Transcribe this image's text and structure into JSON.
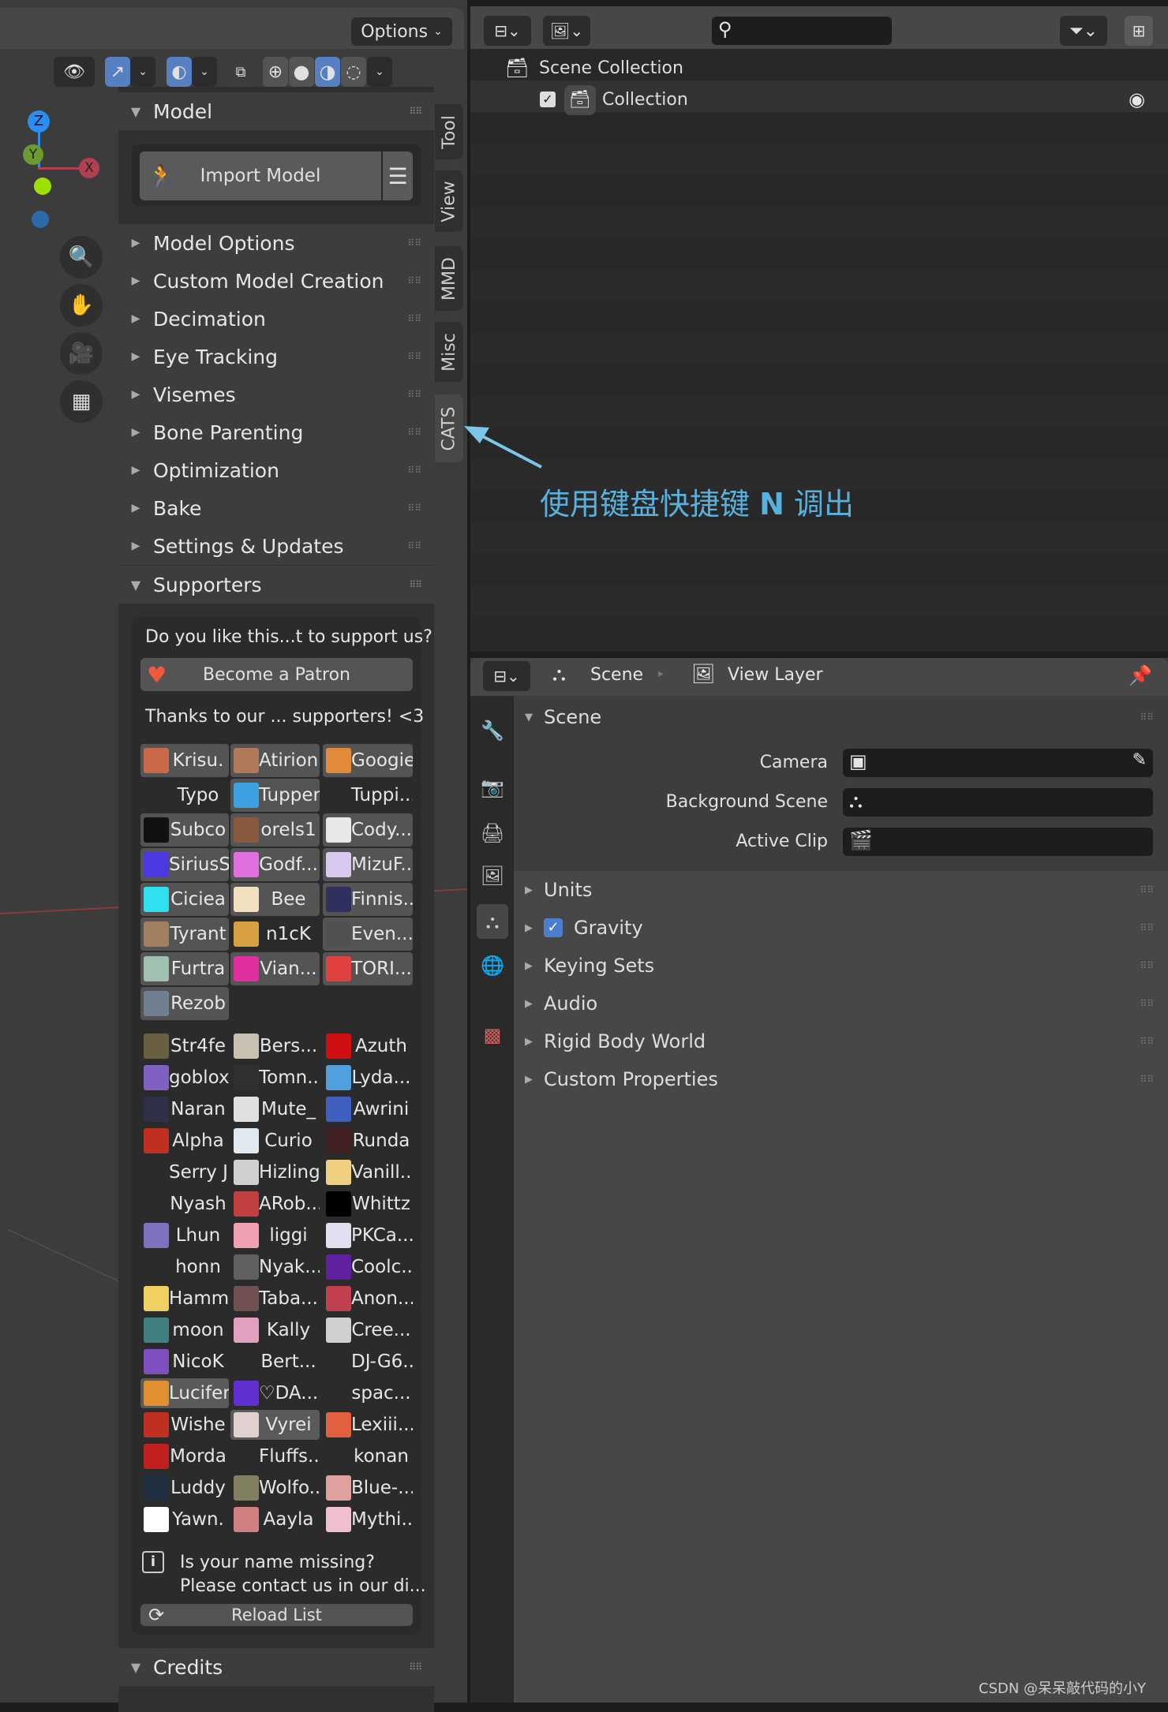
{
  "viewport": {
    "options_label": "Options",
    "gizmo": {
      "z": "Z",
      "y": "Y",
      "x": "X"
    },
    "tabs": [
      "Tool",
      "View",
      "MMD",
      "Misc",
      "CATS"
    ],
    "active_tab": "CATS"
  },
  "sidebar": {
    "model_header": "Model",
    "import_button": "Import Model",
    "items": [
      "Model Options",
      "Custom Model Creation",
      "Decimation",
      "Eye Tracking",
      "Visemes",
      "Bone Parenting",
      "Optimization",
      "Bake",
      "Settings & Updates"
    ],
    "supporters_header": "Supporters",
    "support_prompt": "Do you like this...t to support us?",
    "patron_button": "Become a Patron",
    "thanks": "Thanks to our ... supporters! <3",
    "tier1": [
      [
        "Krisu.",
        "#c86a4a",
        "box"
      ],
      [
        "Atirion",
        "#b07a5a",
        "box"
      ],
      [
        "Googie",
        "#e08a3a",
        "box"
      ],
      [
        "Typo",
        "",
        "dark"
      ],
      [
        "Tupper",
        "#3aa0e0",
        "box"
      ],
      [
        "Tuppi...",
        "",
        "dark"
      ],
      [
        "Subco",
        "#111111",
        "box"
      ],
      [
        "orels1",
        "#8a5a40",
        "box"
      ],
      [
        "Cody...",
        "#e8e8e8",
        "box"
      ],
      [
        "SiriusS",
        "#4a3ae0",
        "box"
      ],
      [
        "Godf...",
        "#e070e0",
        "box"
      ],
      [
        "MizuF...",
        "#d8c8f0",
        "box"
      ],
      [
        "Ciciea",
        "#30e0f0",
        "box"
      ],
      [
        "Bee",
        "#f0e0c0",
        "box"
      ],
      [
        "Finnis...",
        "#303060",
        "box"
      ],
      [
        "Tyrant",
        "#a08060",
        "box"
      ],
      [
        "n1cK",
        "#d8a040",
        "dark"
      ],
      [
        "Even...",
        "#505050",
        "box"
      ],
      [
        "Furtra",
        "#a0c0b0",
        "box"
      ],
      [
        "Vian...",
        "#e030a0",
        "box"
      ],
      [
        "TORI...",
        "#e04040",
        "box"
      ],
      [
        "Rezob",
        "#708090",
        "box"
      ]
    ],
    "tier2": [
      [
        "Str4fe",
        "#6a6040",
        ""
      ],
      [
        "Bers...",
        "#c8c0b0",
        ""
      ],
      [
        "Azuth",
        "#d01010",
        ""
      ],
      [
        "goblox",
        "#8060c0",
        ""
      ],
      [
        "Tomn...",
        "#303030",
        ""
      ],
      [
        "Lyda...",
        "#50a0e0",
        ""
      ],
      [
        "Naran",
        "#303048",
        ""
      ],
      [
        "Mute_",
        "#e0e0e0",
        ""
      ],
      [
        "Awrini",
        "#4060c0",
        ""
      ],
      [
        "Alpha",
        "#c03020",
        ""
      ],
      [
        "Curio",
        "#e0e8f0",
        ""
      ],
      [
        "Runda",
        "#402020",
        ""
      ],
      [
        "Serry J",
        "",
        ""
      ],
      [
        "Hizling",
        "#d0d0d0",
        ""
      ],
      [
        "Vanill...",
        "#f0d080",
        ""
      ],
      [
        "Nyash",
        "",
        ""
      ],
      [
        "ARob...",
        "#c04040",
        ""
      ],
      [
        "Whittz",
        "#000000",
        ""
      ],
      [
        "Lhun",
        "#8070c0",
        ""
      ],
      [
        "liggi",
        "#f0a0b0",
        ""
      ],
      [
        "PKCa...",
        "#e0e0f0",
        ""
      ],
      [
        "honn",
        "",
        ""
      ],
      [
        "Nyak...",
        "#606060",
        ""
      ],
      [
        "Coolc...",
        "#6020a0",
        ""
      ],
      [
        "Hamm",
        "#f0d060",
        ""
      ],
      [
        "Taba...",
        "#705050",
        ""
      ],
      [
        "Anon...",
        "#c04050",
        ""
      ],
      [
        "moon",
        "#408080",
        ""
      ],
      [
        "Kally",
        "#e0a0c0",
        ""
      ],
      [
        "Cree...",
        "#d0d0d0",
        ""
      ],
      [
        "NicoK",
        "#8050c0",
        ""
      ],
      [
        "Bert...",
        "",
        ""
      ],
      [
        "DJ-G6...",
        "",
        ""
      ],
      [
        "Lucifer",
        "#e09030",
        "hl"
      ],
      [
        "♡DA...",
        "#6030d0",
        ""
      ],
      [
        "spac...",
        "",
        ""
      ],
      [
        "Wishe",
        "#c03020",
        ""
      ],
      [
        "Vyrei",
        "#e0d0d0",
        "hl"
      ],
      [
        "Lexiii...",
        "#e06040",
        ""
      ],
      [
        "Morda",
        "#c02020",
        ""
      ],
      [
        "Fluffs...",
        "",
        ""
      ],
      [
        "konan",
        "",
        ""
      ],
      [
        "Luddy",
        "#203040",
        ""
      ],
      [
        "Wolfo...",
        "#808060",
        ""
      ],
      [
        "Blue-...",
        "#e0a0a0",
        ""
      ],
      [
        "Yawn.",
        "#ffffff",
        ""
      ],
      [
        "Aayla",
        "#d08080",
        ""
      ],
      [
        "Mythi...",
        "#f0c0d0",
        ""
      ]
    ],
    "missing_line1": "Is your name missing?",
    "missing_line2": "Please contact us in our di...",
    "reload_button": "Reload List",
    "credits_header": "Credits"
  },
  "outliner": {
    "search_placeholder": "",
    "scene_collection": "Scene Collection",
    "collection": "Collection",
    "collection_checked": true
  },
  "annotation": {
    "text_before": "使用键盘快捷键 ",
    "key": "N",
    "text_after": " 调出",
    "color": "#5ab0dc"
  },
  "properties": {
    "breadcrumb_scene": "Scene",
    "breadcrumb_layer": "View Layer",
    "scene_header": "Scene",
    "camera_label": "Camera",
    "background_label": "Background Scene",
    "clip_label": "Active Clip",
    "panels": [
      "Units",
      "Gravity",
      "Keying Sets",
      "Audio",
      "Rigid Body World",
      "Custom Properties"
    ],
    "gravity_checked": true
  },
  "watermark": "CSDN @呆呆敲代码的小Y"
}
